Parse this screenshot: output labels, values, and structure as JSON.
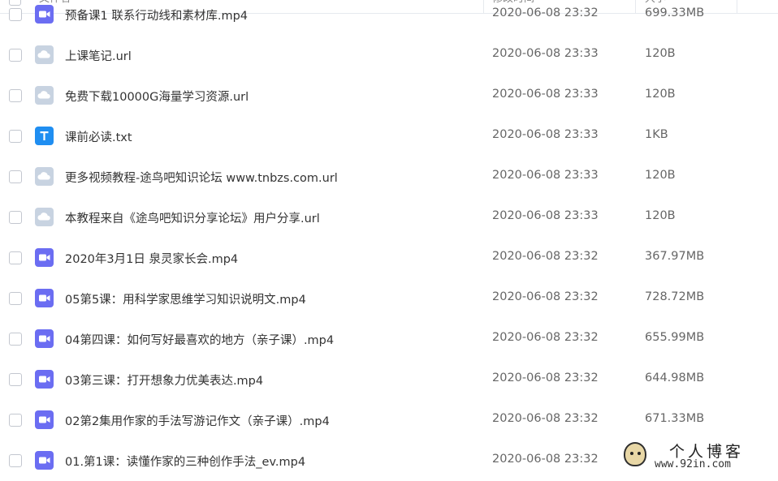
{
  "header": {
    "name_col": "文件名",
    "date_col": "修改时间",
    "size_col": "大小"
  },
  "files": [
    {
      "name": "预备课1 联系行动线和素材库.mp4",
      "date": "2020-06-08 23:32",
      "size": "699.33MB",
      "type": "video"
    },
    {
      "name": "上课笔记.url",
      "date": "2020-06-08 23:33",
      "size": "120B",
      "type": "link"
    },
    {
      "name": "免费下载10000G海量学习资源.url",
      "date": "2020-06-08 23:33",
      "size": "120B",
      "type": "link"
    },
    {
      "name": "课前必读.txt",
      "date": "2020-06-08 23:33",
      "size": "1KB",
      "type": "text"
    },
    {
      "name": "更多视频教程-途鸟吧知识论坛 www.tnbzs.com.url",
      "date": "2020-06-08 23:33",
      "size": "120B",
      "type": "link"
    },
    {
      "name": "本教程来自《途鸟吧知识分享论坛》用户分享.url",
      "date": "2020-06-08 23:33",
      "size": "120B",
      "type": "link"
    },
    {
      "name": "2020年3月1日 泉灵家长会.mp4",
      "date": "2020-06-08 23:32",
      "size": "367.97MB",
      "type": "video"
    },
    {
      "name": "05第5课：用科学家思维学习知识说明文.mp4",
      "date": "2020-06-08 23:32",
      "size": "728.72MB",
      "type": "video"
    },
    {
      "name": "04第四课：如何写好最喜欢的地方（亲子课）.mp4",
      "date": "2020-06-08 23:32",
      "size": "655.99MB",
      "type": "video"
    },
    {
      "name": "03第三课：打开想象力优美表达.mp4",
      "date": "2020-06-08 23:32",
      "size": "644.98MB",
      "type": "video"
    },
    {
      "name": "02第2集用作家的手法写游记作文（亲子课）.mp4",
      "date": "2020-06-08 23:32",
      "size": "671.33MB",
      "type": "video"
    },
    {
      "name": "01.第1课：读懂作家的三种创作手法_ev.mp4",
      "date": "2020-06-08 23:32",
      "size": "",
      "type": "video"
    }
  ],
  "icons": {
    "video": "video-file-icon",
    "link": "link-file-icon",
    "text": "text-file-icon",
    "sort": "sort-arrow-icon"
  },
  "watermark": {
    "title": "个人博客",
    "url": "www.92in.com"
  }
}
